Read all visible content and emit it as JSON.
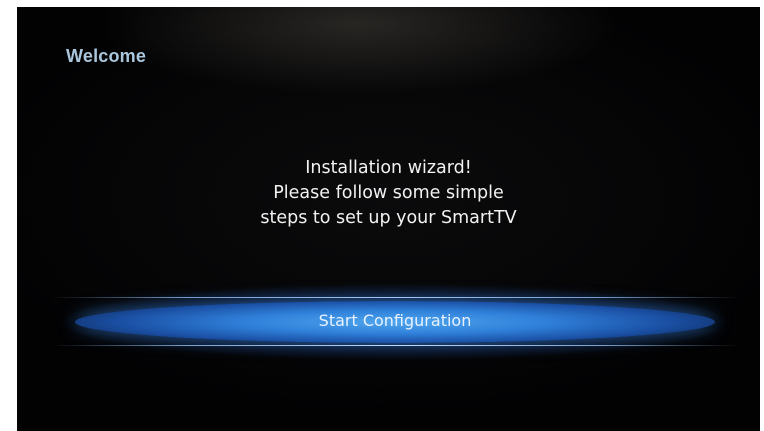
{
  "screen": {
    "title": "Welcome",
    "message_lines": [
      "Installation wizard!",
      "Please follow some simple",
      "steps to set up your SmartTV"
    ],
    "start_button_label": "Start Configuration"
  },
  "colors": {
    "title": "#a9c6dc",
    "text": "#f2f2f2",
    "button_accent": "#2f7fd9",
    "background": "#050506"
  }
}
